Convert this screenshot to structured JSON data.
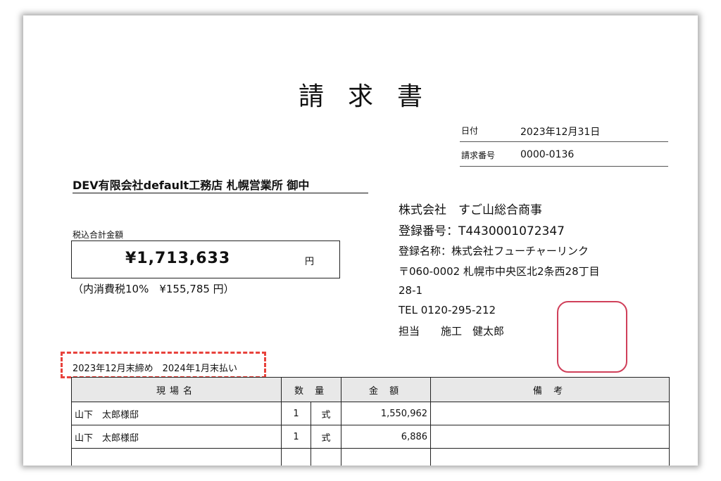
{
  "document": {
    "title": "請求書",
    "date_label": "日付",
    "date_value": "2023年12月31日",
    "number_label": "請求番号",
    "number_value": "0000-0136"
  },
  "recipient": {
    "name_part1": "DEV有限会社",
    "name_part2": "default",
    "name_part3": "工務店 札幌営業所 御中"
  },
  "total": {
    "label": "税込合計金額",
    "amount": "¥1,713,633",
    "yen_unit": "円",
    "tax_note": "（内消費税10%　¥155,785 円）"
  },
  "issuer": {
    "company": "株式会社　すご山総合商事",
    "registration_number": "登録番号：T4430001072347",
    "registration_name": "登録名称：株式会社フューチャーリンク",
    "address_line1": "〒060-0002 札幌市中央区北2条西28丁目",
    "address_line2": "28-1",
    "tel": "TEL 0120-295-212",
    "contact": "担当　　施工　健太郎"
  },
  "closing_terms": "2023年12月末締め　2024年1月末払い",
  "table": {
    "headers": {
      "site": "現場名",
      "quantity": "数 量",
      "amount": "金 額",
      "remarks": "備 考"
    },
    "rows": [
      {
        "site": "山下　太郎様邸",
        "qty": "1",
        "unit": "式",
        "amount": "1,550,962",
        "remarks": ""
      },
      {
        "site": "山下　太郎様邸",
        "qty": "1",
        "unit": "式",
        "amount": "6,886",
        "remarks": ""
      },
      {
        "site": "",
        "qty": "",
        "unit": "",
        "amount": "",
        "remarks": ""
      }
    ]
  },
  "colors": {
    "stamp_border": "#d0405a",
    "highlight_dashed": "#e8423c"
  }
}
